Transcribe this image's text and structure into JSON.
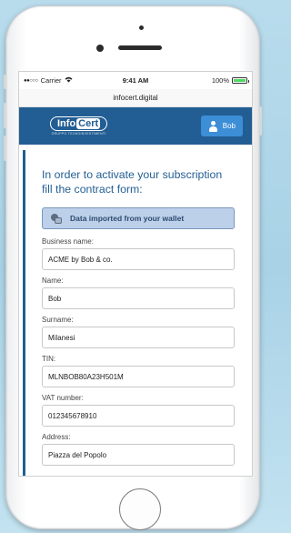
{
  "status_bar": {
    "carrier": "Carrier",
    "time": "9:41 AM",
    "battery": "100%",
    "battery_color": "#4cd964"
  },
  "browser": {
    "url": "infocert.digital"
  },
  "header": {
    "brand_color": "#225e93",
    "logo_text": "Info",
    "logo_accent": "Cert",
    "logo_sub": "GRUPPO TECNOINVESTIMENTI",
    "user_label": "Bob",
    "user_icon": "user-icon"
  },
  "form": {
    "title": "In order to activate your subscription fill the contract form:",
    "wallet_button": "Data imported from your wallet",
    "wallet_icon": "wallet-icon",
    "fields": [
      {
        "label": "Business name:",
        "value": "ACME by Bob & co."
      },
      {
        "label": "Name:",
        "value": "Bob"
      },
      {
        "label": "Surname:",
        "value": "Milanesi"
      },
      {
        "label": "TIN:",
        "value": "MLNBOB80A23H501M"
      },
      {
        "label": "VAT number:",
        "value": "012345678910"
      },
      {
        "label": "Address:",
        "value": "Piazza del Popolo"
      }
    ]
  }
}
